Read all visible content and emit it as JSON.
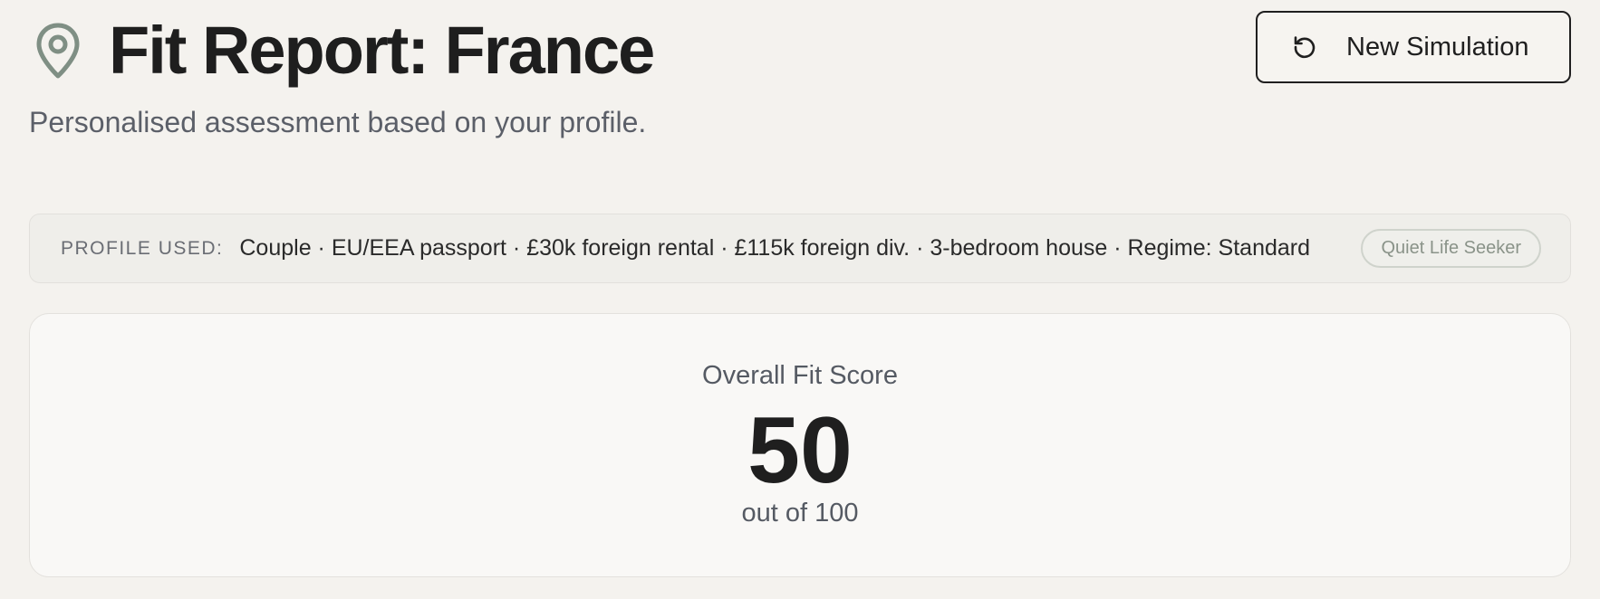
{
  "header": {
    "icon": "map-pin-icon",
    "title": "Fit Report: France",
    "subtitle": "Personalised assessment based on your profile."
  },
  "actions": {
    "new_simulation_icon": "refresh-icon",
    "new_simulation_label": "New Simulation"
  },
  "profile": {
    "label": "PROFILE USED:",
    "summary": "Couple · EU/EEA passport · £30k foreign rental · £115k foreign div. · 3-bedroom house · Regime: Standard",
    "persona": "Quiet Life Seeker"
  },
  "score": {
    "label": "Overall Fit Score",
    "value": "50",
    "out_of": "out of 100"
  },
  "colors": {
    "background": "#f4f2ee",
    "accent_icon": "#7f8f84",
    "text_primary": "#1f1f1f",
    "text_secondary": "#5b5f68"
  }
}
